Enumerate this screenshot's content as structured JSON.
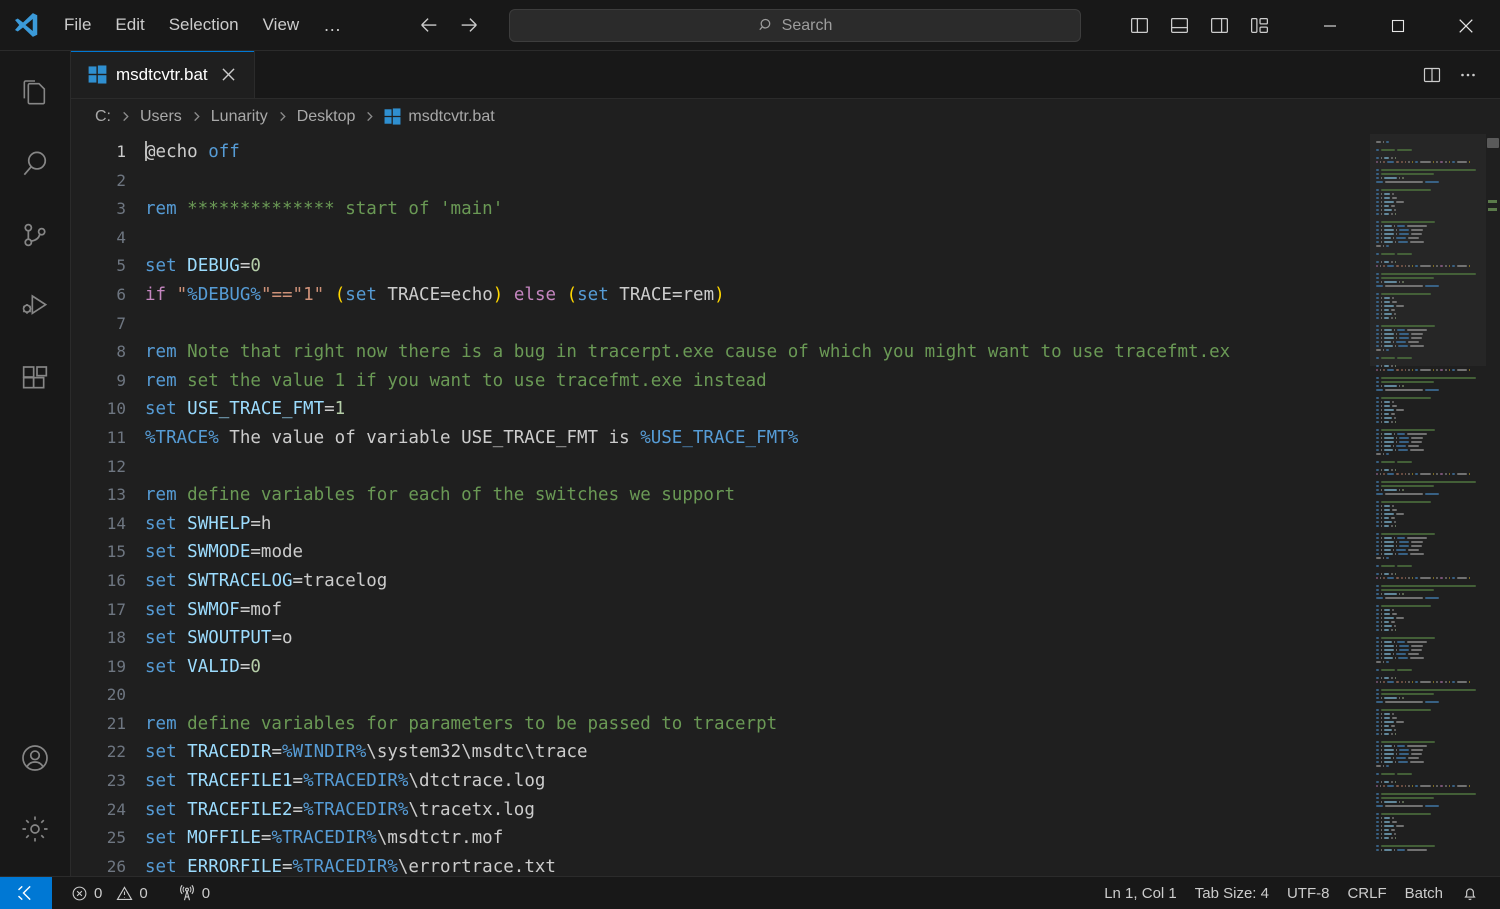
{
  "window": {
    "app_logo": "vscode-logo"
  },
  "titlebar": {
    "menus": [
      "File",
      "Edit",
      "Selection",
      "View"
    ],
    "overflow_label": "…",
    "nav": {
      "back": "arrow-left-icon",
      "forward": "arrow-right-icon"
    },
    "search": {
      "placeholder": "Search",
      "value": "",
      "icon": "search-icon"
    },
    "layout_buttons": [
      {
        "name": "toggle-primary-sidebar",
        "tooltip": "Toggle Primary Side Bar"
      },
      {
        "name": "toggle-panel",
        "tooltip": "Toggle Panel"
      },
      {
        "name": "toggle-secondary-sidebar",
        "tooltip": "Toggle Secondary Side Bar"
      },
      {
        "name": "customize-layout",
        "tooltip": "Customize Layout"
      }
    ],
    "window_controls": [
      "minimize",
      "maximize",
      "close"
    ]
  },
  "activitybar": {
    "items": [
      {
        "name": "explorer",
        "icon": "files-icon",
        "active": false
      },
      {
        "name": "search",
        "icon": "search-icon",
        "active": false
      },
      {
        "name": "source-control",
        "icon": "source-control-icon",
        "active": false
      },
      {
        "name": "run-and-debug",
        "icon": "run-debug-icon",
        "active": false
      },
      {
        "name": "extensions",
        "icon": "extensions-icon",
        "active": false
      }
    ],
    "bottom_items": [
      {
        "name": "accounts",
        "icon": "account-icon"
      },
      {
        "name": "manage-settings",
        "icon": "gear-icon"
      }
    ]
  },
  "tabs": {
    "items": [
      {
        "label": "msdtcvtr.bat",
        "icon": "windows-batch-icon",
        "active": true,
        "close_icon": "close-icon"
      }
    ],
    "actions": [
      {
        "name": "split-editor-right",
        "icon": "split-editor-icon"
      },
      {
        "name": "more-actions",
        "icon": "ellipsis-icon"
      }
    ]
  },
  "breadcrumbs": {
    "items": [
      "C:",
      "Users",
      "Lunarity",
      "Desktop",
      "msdtcvtr.bat"
    ],
    "file_icon": "windows-batch-icon"
  },
  "editor": {
    "language": "Batch",
    "first_visible_line": 1,
    "lines": [
      {
        "n": 1,
        "tokens": [
          {
            "t": "@echo",
            "c": "tok-text"
          },
          {
            "t": " ",
            "c": "tok-text"
          },
          {
            "t": "off",
            "c": "tok-kw"
          }
        ]
      },
      {
        "n": 2,
        "tokens": []
      },
      {
        "n": 3,
        "tokens": [
          {
            "t": "rem",
            "c": "tok-kw"
          },
          {
            "t": " **************",
            "c": "tok-comment"
          },
          {
            "t": " start of 'main'",
            "c": "tok-comment"
          }
        ]
      },
      {
        "n": 4,
        "tokens": []
      },
      {
        "n": 5,
        "tokens": [
          {
            "t": "set",
            "c": "tok-kw"
          },
          {
            "t": " ",
            "c": "tok-text"
          },
          {
            "t": "DEBUG",
            "c": "tok-var"
          },
          {
            "t": "=",
            "c": "tok-text"
          },
          {
            "t": "0",
            "c": "tok-num"
          }
        ]
      },
      {
        "n": 6,
        "tokens": [
          {
            "t": "if",
            "c": "tok-ctrl"
          },
          {
            "t": " ",
            "c": "tok-text"
          },
          {
            "t": "\"",
            "c": "tok-str"
          },
          {
            "t": "%DEBUG%",
            "c": "tok-kw"
          },
          {
            "t": "\"==\"",
            "c": "tok-str"
          },
          {
            "t": "1",
            "c": "tok-str"
          },
          {
            "t": "\"",
            "c": "tok-str"
          },
          {
            "t": " ",
            "c": "tok-text"
          },
          {
            "t": "(",
            "c": "tok-paren"
          },
          {
            "t": "set",
            "c": "tok-kw"
          },
          {
            "t": " TRACE=echo",
            "c": "tok-text"
          },
          {
            "t": ")",
            "c": "tok-paren"
          },
          {
            "t": " ",
            "c": "tok-text"
          },
          {
            "t": "else",
            "c": "tok-ctrl"
          },
          {
            "t": " ",
            "c": "tok-text"
          },
          {
            "t": "(",
            "c": "tok-paren"
          },
          {
            "t": "set",
            "c": "tok-kw"
          },
          {
            "t": " TRACE=rem",
            "c": "tok-text"
          },
          {
            "t": ")",
            "c": "tok-paren"
          }
        ]
      },
      {
        "n": 7,
        "tokens": []
      },
      {
        "n": 8,
        "tokens": [
          {
            "t": "rem",
            "c": "tok-kw"
          },
          {
            "t": " Note that right now there is a bug in tracerpt.exe cause of which you might want to use tracefmt.ex",
            "c": "tok-comment"
          }
        ]
      },
      {
        "n": 9,
        "tokens": [
          {
            "t": "rem",
            "c": "tok-kw"
          },
          {
            "t": " set the value 1 if you want to use tracefmt.exe instead",
            "c": "tok-comment"
          }
        ]
      },
      {
        "n": 10,
        "tokens": [
          {
            "t": "set",
            "c": "tok-kw"
          },
          {
            "t": " ",
            "c": "tok-text"
          },
          {
            "t": "USE_TRACE_FMT",
            "c": "tok-var"
          },
          {
            "t": "=",
            "c": "tok-text"
          },
          {
            "t": "1",
            "c": "tok-num"
          }
        ]
      },
      {
        "n": 11,
        "tokens": [
          {
            "t": "%TRACE%",
            "c": "tok-kw"
          },
          {
            "t": " The value of variable USE_TRACE_FMT is ",
            "c": "tok-text"
          },
          {
            "t": "%USE_TRACE_FMT%",
            "c": "tok-kw"
          }
        ]
      },
      {
        "n": 12,
        "tokens": []
      },
      {
        "n": 13,
        "tokens": [
          {
            "t": "rem",
            "c": "tok-kw"
          },
          {
            "t": " define variables for each of the switches we support",
            "c": "tok-comment"
          }
        ]
      },
      {
        "n": 14,
        "tokens": [
          {
            "t": "set",
            "c": "tok-kw"
          },
          {
            "t": " ",
            "c": "tok-text"
          },
          {
            "t": "SWHELP",
            "c": "tok-var"
          },
          {
            "t": "=h",
            "c": "tok-text"
          }
        ]
      },
      {
        "n": 15,
        "tokens": [
          {
            "t": "set",
            "c": "tok-kw"
          },
          {
            "t": " ",
            "c": "tok-text"
          },
          {
            "t": "SWMODE",
            "c": "tok-var"
          },
          {
            "t": "=mode",
            "c": "tok-text"
          }
        ]
      },
      {
        "n": 16,
        "tokens": [
          {
            "t": "set",
            "c": "tok-kw"
          },
          {
            "t": " ",
            "c": "tok-text"
          },
          {
            "t": "SWTRACELOG",
            "c": "tok-var"
          },
          {
            "t": "=tracelog",
            "c": "tok-text"
          }
        ]
      },
      {
        "n": 17,
        "tokens": [
          {
            "t": "set",
            "c": "tok-kw"
          },
          {
            "t": " ",
            "c": "tok-text"
          },
          {
            "t": "SWMOF",
            "c": "tok-var"
          },
          {
            "t": "=mof",
            "c": "tok-text"
          }
        ]
      },
      {
        "n": 18,
        "tokens": [
          {
            "t": "set",
            "c": "tok-kw"
          },
          {
            "t": " ",
            "c": "tok-text"
          },
          {
            "t": "SWOUTPUT",
            "c": "tok-var"
          },
          {
            "t": "=o",
            "c": "tok-text"
          }
        ]
      },
      {
        "n": 19,
        "tokens": [
          {
            "t": "set",
            "c": "tok-kw"
          },
          {
            "t": " ",
            "c": "tok-text"
          },
          {
            "t": "VALID",
            "c": "tok-var"
          },
          {
            "t": "=",
            "c": "tok-text"
          },
          {
            "t": "0",
            "c": "tok-num"
          }
        ]
      },
      {
        "n": 20,
        "tokens": []
      },
      {
        "n": 21,
        "tokens": [
          {
            "t": "rem",
            "c": "tok-kw"
          },
          {
            "t": " define variables for parameters to be passed to tracerpt",
            "c": "tok-comment"
          }
        ]
      },
      {
        "n": 22,
        "tokens": [
          {
            "t": "set",
            "c": "tok-kw"
          },
          {
            "t": " ",
            "c": "tok-text"
          },
          {
            "t": "TRACEDIR",
            "c": "tok-var"
          },
          {
            "t": "=",
            "c": "tok-text"
          },
          {
            "t": "%WINDIR%",
            "c": "tok-kw"
          },
          {
            "t": "\\system32\\msdtc\\trace",
            "c": "tok-text"
          }
        ]
      },
      {
        "n": 23,
        "tokens": [
          {
            "t": "set",
            "c": "tok-kw"
          },
          {
            "t": " ",
            "c": "tok-text"
          },
          {
            "t": "TRACEFILE1",
            "c": "tok-var"
          },
          {
            "t": "=",
            "c": "tok-text"
          },
          {
            "t": "%TRACEDIR%",
            "c": "tok-kw"
          },
          {
            "t": "\\dtctrace.log",
            "c": "tok-text"
          }
        ]
      },
      {
        "n": 24,
        "tokens": [
          {
            "t": "set",
            "c": "tok-kw"
          },
          {
            "t": " ",
            "c": "tok-text"
          },
          {
            "t": "TRACEFILE2",
            "c": "tok-var"
          },
          {
            "t": "=",
            "c": "tok-text"
          },
          {
            "t": "%TRACEDIR%",
            "c": "tok-kw"
          },
          {
            "t": "\\tracetx.log",
            "c": "tok-text"
          }
        ]
      },
      {
        "n": 25,
        "tokens": [
          {
            "t": "set",
            "c": "tok-kw"
          },
          {
            "t": " ",
            "c": "tok-text"
          },
          {
            "t": "MOFFILE",
            "c": "tok-var"
          },
          {
            "t": "=",
            "c": "tok-text"
          },
          {
            "t": "%TRACEDIR%",
            "c": "tok-kw"
          },
          {
            "t": "\\msdtctr.mof",
            "c": "tok-text"
          }
        ]
      },
      {
        "n": 26,
        "tokens": [
          {
            "t": "set",
            "c": "tok-kw"
          },
          {
            "t": " ",
            "c": "tok-text"
          },
          {
            "t": "ERRORFILE",
            "c": "tok-var"
          },
          {
            "t": "=",
            "c": "tok-text"
          },
          {
            "t": "%TRACEDIR%",
            "c": "tok-kw"
          },
          {
            "t": "\\errortrace.txt",
            "c": "tok-text"
          }
        ]
      }
    ]
  },
  "statusbar": {
    "remote": {
      "icon": "remote-indicator-icon",
      "label": ""
    },
    "left": [
      {
        "name": "problems-errors",
        "icon": "error-icon",
        "value": "0"
      },
      {
        "name": "problems-warnings",
        "icon": "warning-icon",
        "value": "0"
      },
      {
        "name": "ports",
        "icon": "radio-tower-icon",
        "value": "0"
      }
    ],
    "right": [
      {
        "name": "editor-position",
        "label": "Ln 1, Col 1"
      },
      {
        "name": "editor-indentation",
        "label": "Tab Size: 4"
      },
      {
        "name": "editor-encoding",
        "label": "UTF-8"
      },
      {
        "name": "editor-eol",
        "label": "CRLF"
      },
      {
        "name": "editor-language",
        "label": "Batch"
      },
      {
        "name": "notifications",
        "label": "",
        "icon": "bell-icon"
      }
    ]
  },
  "colors": {
    "accent": "#0078d4",
    "editor_background": "#1f1f1f",
    "chrome_background": "#181818",
    "comment": "#6a9955",
    "keyword": "#569cd6",
    "control": "#c586c0",
    "string": "#ce9178",
    "variable": "#9cdcfe",
    "number": "#b5cea8",
    "bracket": "#ffd700"
  }
}
